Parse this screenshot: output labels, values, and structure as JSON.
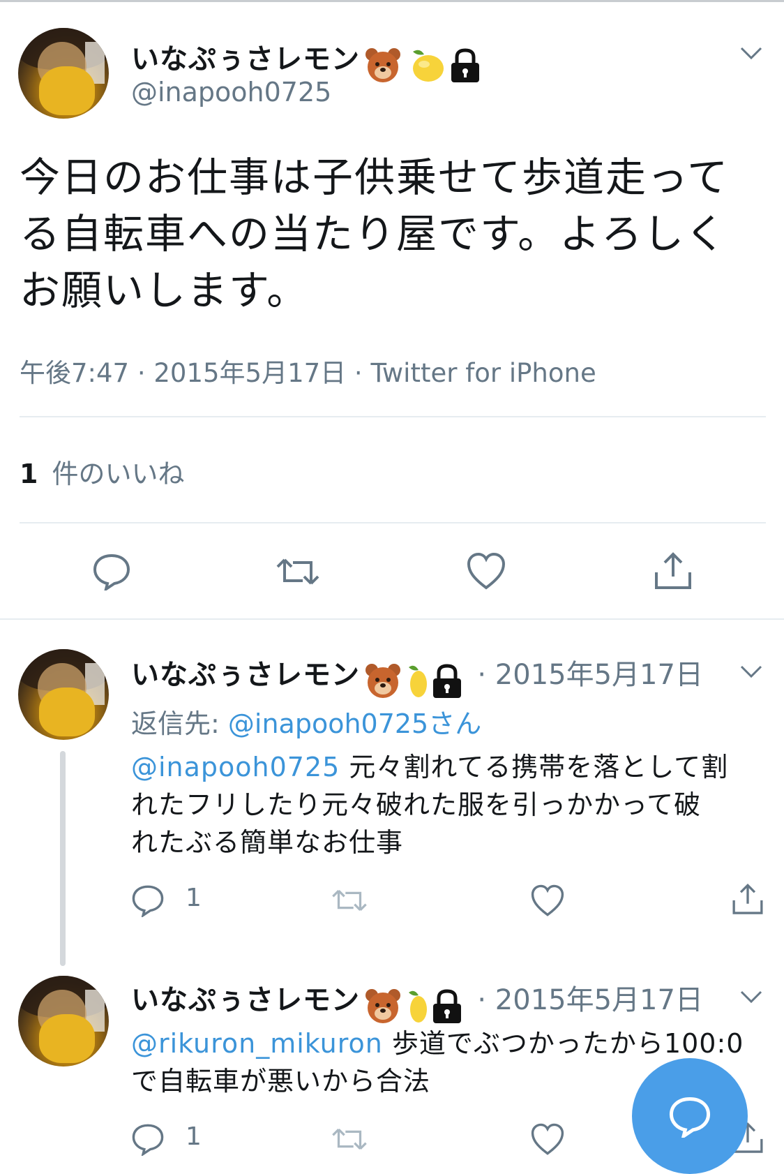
{
  "main_tweet": {
    "display_name": "いなぷぅさレモン",
    "handle": "@inapooh0725",
    "text_lines": [
      "今日のお仕事は子供乗せて歩道走って",
      "る自転車への当たり屋です。よろしく",
      "お願いします。"
    ],
    "meta": "午後7:47 · 2015年5月17日 · Twitter for iPhone",
    "likes_count": "1",
    "likes_label": "件のいいね"
  },
  "replies": [
    {
      "display_name": "いなぷぅさレモン",
      "date": "· 2015年5月17日",
      "reply_to_label": "返信先: ",
      "reply_to_handle": "@inapooh0725",
      "reply_to_suffix": "さん",
      "mention": "@inapooh0725",
      "text_line1": " 元々割れてる携帯を落として割",
      "text_line2": "れたフリしたり元々破れた服を引っかかって破",
      "text_line3": "れたぶる簡単なお仕事",
      "reply_count": "1"
    },
    {
      "display_name": "いなぷぅさレモン",
      "date": "· 2015年5月17日",
      "mention": "@rikuron_mikuron",
      "text_line1": " 歩道でぶつかったから100:0",
      "text_line2": "で自転車が悪いから合法",
      "reply_count": "1"
    }
  ],
  "colors": {
    "link": "#3b94d9",
    "secondary": "#657786",
    "fab": "#4a9ee8"
  },
  "icons": [
    "reply-icon",
    "retweet-icon",
    "like-icon",
    "share-icon",
    "chevron-down-icon",
    "lock-icon",
    "bear-emoji-icon",
    "lemon-emoji-icon",
    "compose-reply-icon"
  ]
}
